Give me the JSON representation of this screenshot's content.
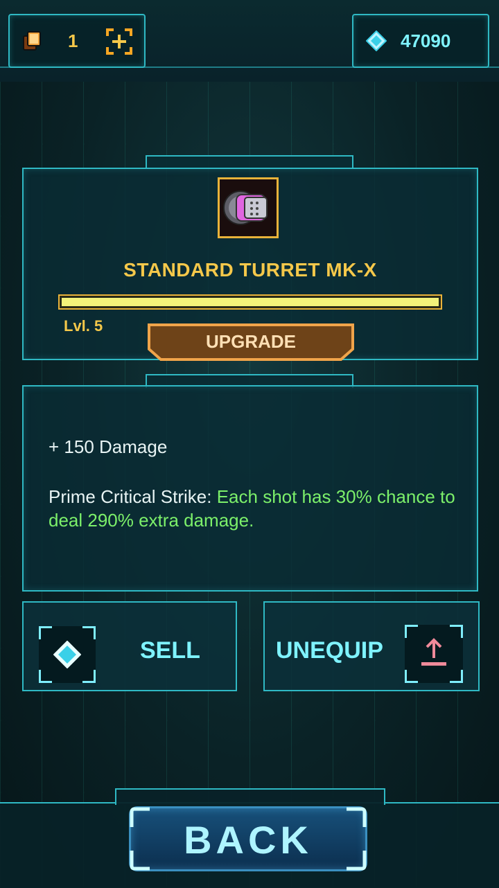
{
  "header": {
    "cards_count": "1",
    "gems_count": "47090"
  },
  "item": {
    "name": "STANDARD TURRET MK-X",
    "level_label": "Lvl. 5",
    "progress": 1.0,
    "upgrade_label": "UPGRADE"
  },
  "stats": {
    "damage_line": "+ 150 Damage",
    "ability_name": "Prime Critical Strike: ",
    "ability_desc": "Each shot has 30% chance to deal 290% extra damage."
  },
  "actions": {
    "sell_label": "SELL",
    "unequip_label": "UNEQUIP"
  },
  "footer": {
    "back_label": "BACK"
  },
  "colors": {
    "accent": "#2fb9c4",
    "gold": "#f5c84a",
    "green": "#7cf06a",
    "cyan_text": "#7ff3ff"
  },
  "icons": {
    "cards": "cards-icon",
    "add": "add-icon",
    "gem": "gem-icon",
    "turret": "turret-icon",
    "unequip": "unequip-arrow-icon"
  }
}
